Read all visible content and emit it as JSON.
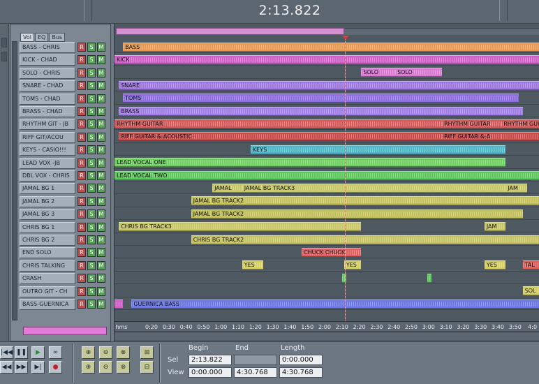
{
  "app": {
    "time_display": "2:13.822"
  },
  "panel": {
    "tabs": [
      "Vol",
      "EQ",
      "Bus"
    ],
    "rsm_labels": {
      "record": "R",
      "solo": "S",
      "mute": "M"
    }
  },
  "tracks": [
    {
      "name": "BASS - CHRIS",
      "color": "#e89a55"
    },
    {
      "name": "KICK - CHAD",
      "color": "#d060c8"
    },
    {
      "name": "SOLO - CHRIS",
      "color": "#d978d0"
    },
    {
      "name": "SNARE - CHAD",
      "color": "#9e78e0"
    },
    {
      "name": "TOMS - CHAD",
      "color": "#8c6ee0"
    },
    {
      "name": "BRASS - CHAD",
      "color": "#a07ce6"
    },
    {
      "name": "RHYTHM GIT - JB",
      "color": "#d65a5a"
    },
    {
      "name": "RIFF GIT/ACOU",
      "color": "#c94a4a"
    },
    {
      "name": "KEYS - CASIO!!!",
      "color": "#4fb8c8"
    },
    {
      "name": "LEAD VOX -JB",
      "color": "#6ed060"
    },
    {
      "name": "DBL VOX - CHRIS",
      "color": "#5cc85c"
    },
    {
      "name": "JAMAL BG 1",
      "color": "#c6c866"
    },
    {
      "name": "JAMAL BG 2",
      "color": "#c4c25a"
    },
    {
      "name": "JAMAL BG 3",
      "color": "#c2c058"
    },
    {
      "name": "CHRIS BG 1",
      "color": "#c8c666"
    },
    {
      "name": "CHRIS BG 2",
      "color": "#c6c462"
    },
    {
      "name": "END SOLO",
      "color": "#e06060"
    },
    {
      "name": "CHRIS TALKING",
      "color": "#d6d060"
    },
    {
      "name": "CRASH",
      "color": "#60c860"
    },
    {
      "name": "OUTRO GIT - CH",
      "color": "#d4cf60"
    },
    {
      "name": "BASS-GUERNICA",
      "color": "#6a78e6"
    }
  ],
  "clips": [
    {
      "row": 0,
      "start": 0.02,
      "end": 1.0,
      "label": "BASS",
      "color": "#e89a55"
    },
    {
      "row": 1,
      "start": 0.0,
      "end": 1.0,
      "label": "KICK",
      "color": "#d060c8"
    },
    {
      "row": 2,
      "start": 0.58,
      "end": 0.66,
      "label": "SOLO",
      "color": "#d978d0"
    },
    {
      "row": 2,
      "start": 0.66,
      "end": 0.77,
      "label": "SOLO",
      "color": "#d978d0"
    },
    {
      "row": 3,
      "start": 0.01,
      "end": 1.0,
      "label": "SNARE",
      "color": "#9e78e0"
    },
    {
      "row": 4,
      "start": 0.02,
      "end": 0.95,
      "label": "TOMS",
      "color": "#8c6ee0"
    },
    {
      "row": 5,
      "start": 0.01,
      "end": 0.96,
      "label": "BRASS",
      "color": "#a07ce6"
    },
    {
      "row": 6,
      "start": 0.0,
      "end": 0.77,
      "label": "RHYTHM GUITAR",
      "color": "#d65a5a"
    },
    {
      "row": 6,
      "start": 0.77,
      "end": 0.91,
      "label": "RHYTHM GUITAR",
      "color": "#d65a5a"
    },
    {
      "row": 6,
      "start": 0.91,
      "end": 1.0,
      "label": "RHYTHM GUI",
      "color": "#d65a5a"
    },
    {
      "row": 7,
      "start": 0.01,
      "end": 0.77,
      "label": "RIFF GUITAR & ACOUSTIC",
      "color": "#c94a4a"
    },
    {
      "row": 7,
      "start": 0.77,
      "end": 0.91,
      "label": "RIFF GUITAR & A",
      "color": "#c94a4a"
    },
    {
      "row": 7,
      "start": 0.91,
      "end": 1.0,
      "label": "",
      "color": "#c94a4a"
    },
    {
      "row": 8,
      "start": 0.32,
      "end": 0.92,
      "label": "KEYS",
      "color": "#4fb8c8"
    },
    {
      "row": 9,
      "start": 0.0,
      "end": 0.34,
      "label": "LEAD VOCAL ONE",
      "color": "#6ed060"
    },
    {
      "row": 9,
      "start": 0.34,
      "end": 0.92,
      "label": "",
      "color": "#6ed060"
    },
    {
      "row": 10,
      "start": 0.0,
      "end": 1.0,
      "label": "LEAD VOCAL TWO",
      "color": "#5cc85c"
    },
    {
      "row": 11,
      "start": 0.23,
      "end": 0.3,
      "label": "JAMAL",
      "color": "#c6c866"
    },
    {
      "row": 11,
      "start": 0.3,
      "end": 0.92,
      "label": "JAMAL BG TRACK3",
      "color": "#c6c866"
    },
    {
      "row": 11,
      "start": 0.92,
      "end": 0.97,
      "label": "JAM",
      "color": "#c6c866"
    },
    {
      "row": 12,
      "start": 0.18,
      "end": 1.0,
      "label": "JAMAL BG TRACK2",
      "color": "#c4c25a"
    },
    {
      "row": 13,
      "start": 0.18,
      "end": 0.96,
      "label": "JAMAL BG TRACK2",
      "color": "#c2c058"
    },
    {
      "row": 14,
      "start": 0.01,
      "end": 0.58,
      "label": "CHRIS BG TRACK3",
      "color": "#c8c666"
    },
    {
      "row": 14,
      "start": 0.87,
      "end": 0.92,
      "label": "JAM",
      "color": "#c8c666"
    },
    {
      "row": 15,
      "start": 0.18,
      "end": 1.0,
      "label": "CHRIS BG TRACK2",
      "color": "#c6c462"
    },
    {
      "row": 16,
      "start": 0.44,
      "end": 0.58,
      "label": "CHUCK CHUCK",
      "color": "#e06060"
    },
    {
      "row": 17,
      "start": 0.3,
      "end": 0.35,
      "label": "YES",
      "color": "#d6d060"
    },
    {
      "row": 17,
      "start": 0.54,
      "end": 0.58,
      "label": "YES",
      "color": "#d6d060"
    },
    {
      "row": 17,
      "start": 0.87,
      "end": 0.92,
      "label": "YES",
      "color": "#d6d060"
    },
    {
      "row": 17,
      "start": 0.96,
      "end": 1.0,
      "label": "TAL",
      "color": "#e06060"
    },
    {
      "row": 18,
      "start": 0.535,
      "end": 0.545,
      "label": "",
      "color": "#60c860"
    },
    {
      "row": 18,
      "start": 0.735,
      "end": 0.745,
      "label": "",
      "color": "#60c860"
    },
    {
      "row": 19,
      "start": 0.96,
      "end": 1.0,
      "label": "SOL",
      "color": "#d4cf60"
    },
    {
      "row": 20,
      "start": 0.0,
      "end": 0.02,
      "label": "",
      "color": "#d060c8"
    },
    {
      "row": 20,
      "start": 0.04,
      "end": 1.0,
      "label": "GUERNICA BASS",
      "color": "#6a78e6"
    }
  ],
  "ruler": {
    "ticks": [
      "hms",
      "0:20",
      "0:30",
      "0:40",
      "0:50",
      "1:00",
      "1:10",
      "1:20",
      "1:30",
      "1:40",
      "1:50",
      "2:00",
      "2:10",
      "2:20",
      "2:30",
      "2:40",
      "2:50",
      "3:00",
      "3:10",
      "3:20",
      "3:30",
      "3:40",
      "3:50",
      "4:0"
    ]
  },
  "transport": {
    "rewind": "|◀◀",
    "pause": "❚❚",
    "play": "▶",
    "loop": "∞",
    "prev": "◀◀",
    "forward": "▶▶",
    "end": "▶|",
    "record": "●"
  },
  "zoom_tools": {
    "zoom_in": "⊕",
    "zoom_out": "⊖",
    "zoom_full": "⊗",
    "zoom_sel": "⊞",
    "zoom_in_v": "⊕",
    "zoom_out_v": "⊖",
    "zoom_full_v": "⊗",
    "zoom_sel_v": "⊟"
  },
  "selection": {
    "headers": [
      "Begin",
      "End",
      "Length"
    ],
    "rows": [
      {
        "label": "Sel",
        "begin": "2:13.822",
        "end": "",
        "length": "0:00.000"
      },
      {
        "label": "View",
        "begin": "0:00.000",
        "end": "4:30.768",
        "length": "4:30.768"
      }
    ]
  }
}
